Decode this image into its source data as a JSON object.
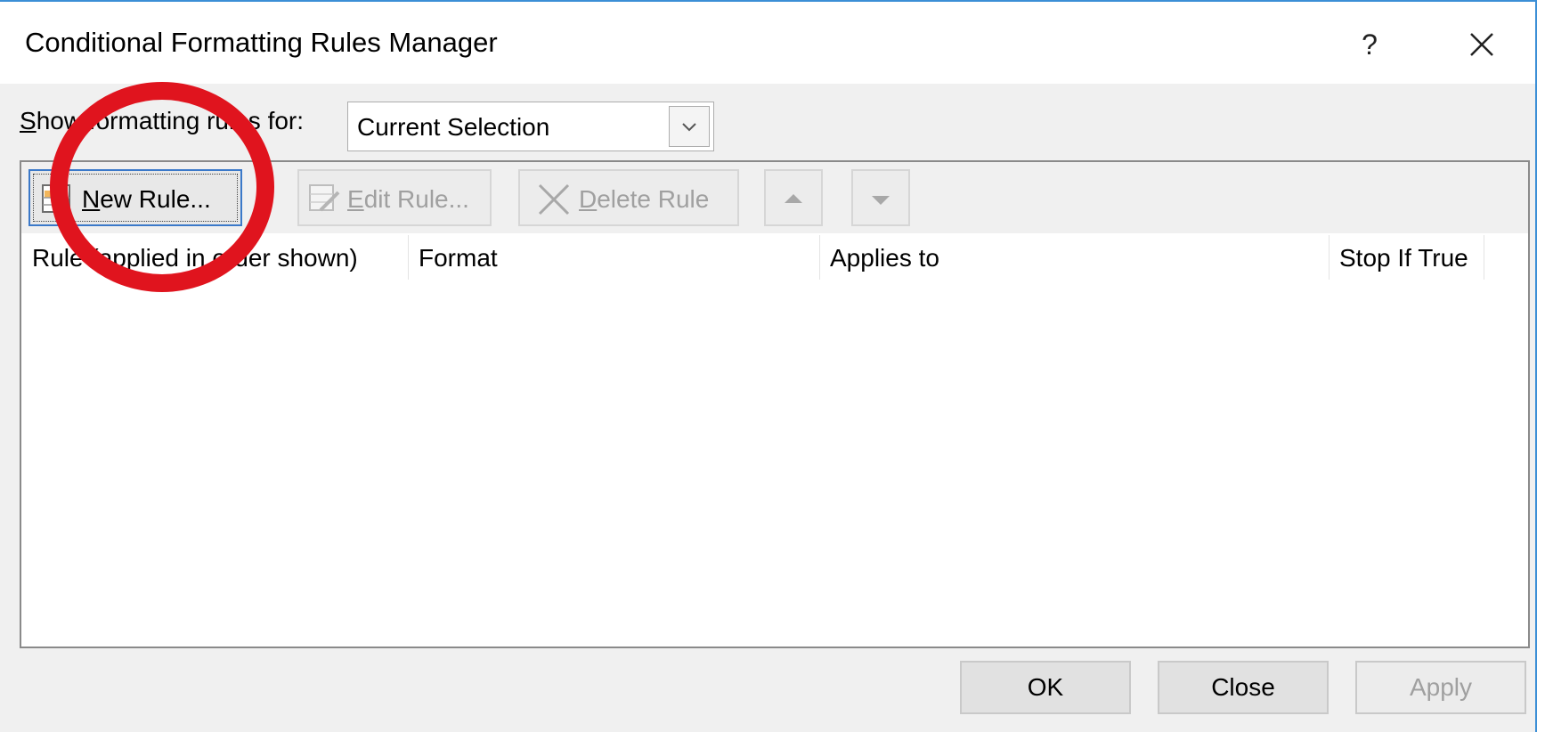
{
  "dialog": {
    "title": "Conditional Formatting Rules Manager",
    "help_label": "?"
  },
  "scope": {
    "label_accel": "S",
    "label_rest": "how formatting rules for:",
    "selected": "Current Selection"
  },
  "toolbar": {
    "new_rule_accel": "N",
    "new_rule_rest": "ew Rule...",
    "edit_rule_accel": "E",
    "edit_rule_rest": "dit Rule...",
    "delete_rule_accel": "D",
    "delete_rule_rest": "elete Rule"
  },
  "columns": [
    "Rule (applied in order shown)",
    "Format",
    "Applies to",
    "Stop If True"
  ],
  "buttons": {
    "ok": "OK",
    "close": "Close",
    "apply": "Apply"
  },
  "colors": {
    "annotation_circle": "#e0141e",
    "focus_border": "#3b79c9",
    "window_border": "#3c8fd6"
  }
}
